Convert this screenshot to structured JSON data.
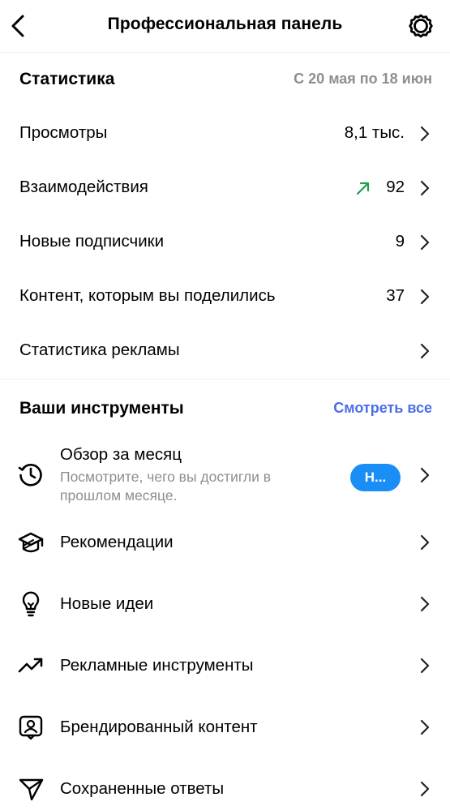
{
  "header": {
    "title": "Профессиональная панель"
  },
  "stats": {
    "title": "Статистика",
    "date_range": "С 20 мая по 18 июн",
    "rows": [
      {
        "label": "Просмотры",
        "value": "8,1 тыс."
      },
      {
        "label": "Взаимодействия",
        "value": "92",
        "trend": "up"
      },
      {
        "label": "Новые подписчики",
        "value": "9"
      },
      {
        "label": "Контент, которым вы поделились",
        "value": "37"
      },
      {
        "label": "Статистика рекламы",
        "value": ""
      }
    ]
  },
  "tools": {
    "title": "Ваши инструменты",
    "see_all": "Смотреть все",
    "items": [
      {
        "label": "Обзор за месяц",
        "subtitle": "Посмотрите, чего вы достигли в прошлом месяце.",
        "badge": "Н...",
        "icon": "history-clock-icon"
      },
      {
        "label": "Рекомендации",
        "icon": "graduation-cap-icon"
      },
      {
        "label": "Новые идеи",
        "icon": "lightbulb-icon"
      },
      {
        "label": "Рекламные инструменты",
        "icon": "trending-up-icon"
      },
      {
        "label": "Брендированный контент",
        "icon": "person-badge-icon"
      },
      {
        "label": "Сохраненные ответы",
        "icon": "send-paper-plane-icon"
      }
    ]
  },
  "colors": {
    "accent_blue": "#4b6ee8",
    "badge_blue": "#1a8ef7",
    "trend_green": "#1f9e4a",
    "secondary_text": "#8e8e8e"
  }
}
